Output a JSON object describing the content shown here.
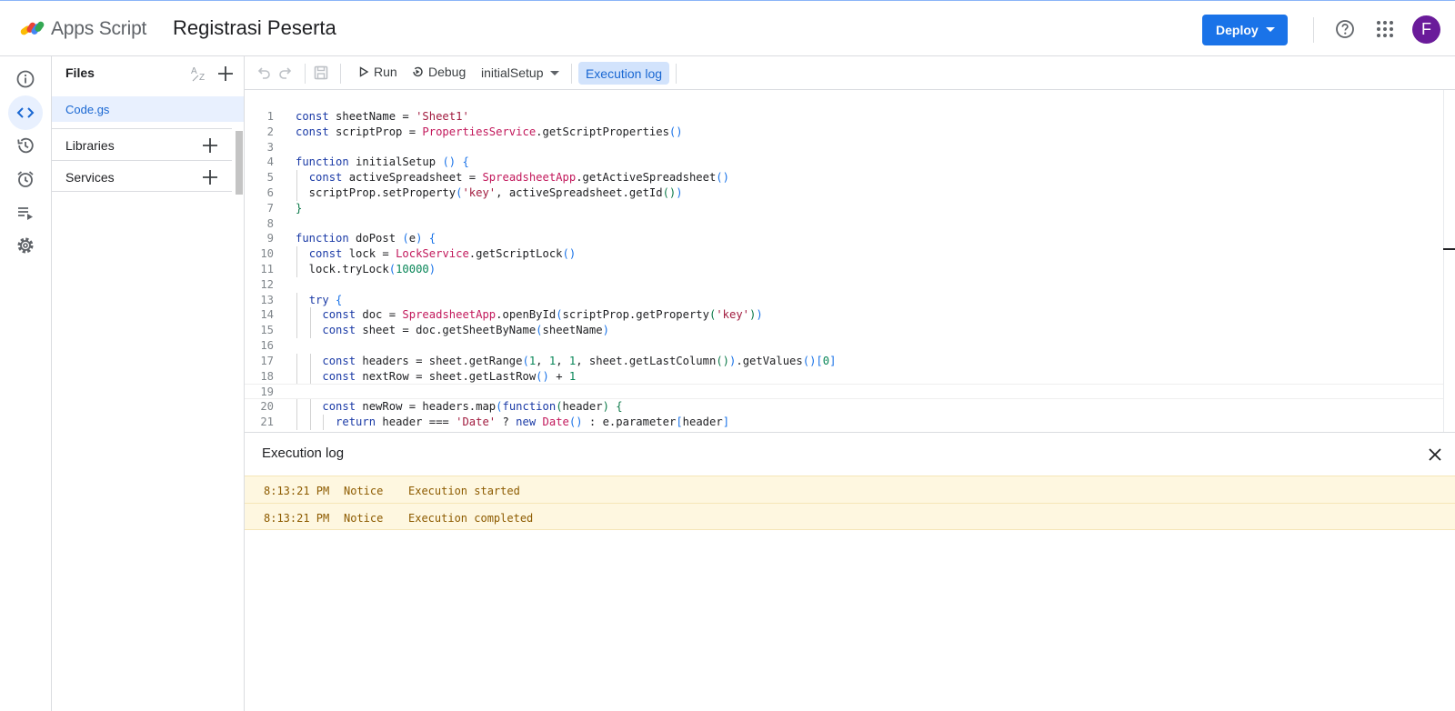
{
  "header": {
    "app_name": "Apps Script",
    "project_title": "Registrasi Peserta",
    "deploy_label": "Deploy",
    "avatar_initial": "F"
  },
  "rail": {
    "icons": [
      "info-icon",
      "code-icon",
      "history-icon",
      "alarm-icon",
      "executions-icon",
      "settings-icon"
    ],
    "active": "code-icon"
  },
  "files": {
    "title": "Files",
    "items": [
      {
        "name": "Code.gs",
        "selected": true
      }
    ],
    "sections": [
      {
        "label": "Libraries"
      },
      {
        "label": "Services"
      }
    ]
  },
  "toolbar": {
    "run_label": "Run",
    "debug_label": "Debug",
    "function_selected": "initialSetup",
    "exec_log_label": "Execution log"
  },
  "editor": {
    "current_line": 19,
    "lines": [
      "const sheetName = 'Sheet1'",
      "const scriptProp = PropertiesService.getScriptProperties()",
      "",
      "function initialSetup () {",
      "  const activeSpreadsheet = SpreadsheetApp.getActiveSpreadsheet()",
      "  scriptProp.setProperty('key', activeSpreadsheet.getId())",
      "}",
      "",
      "function doPost (e) {",
      "  const lock = LockService.getScriptLock()",
      "  lock.tryLock(10000)",
      "",
      "  try {",
      "    const doc = SpreadsheetApp.openById(scriptProp.getProperty('key'))",
      "    const sheet = doc.getSheetByName(sheetName)",
      "",
      "    const headers = sheet.getRange(1, 1, 1, sheet.getLastColumn()).getValues()[0]",
      "    const nextRow = sheet.getLastRow() + 1",
      "",
      "    const newRow = headers.map(function(header) {",
      "      return header === 'Date' ? new Date() : e.parameter[header]"
    ]
  },
  "execution_log": {
    "title": "Execution log",
    "entries": [
      {
        "time": "8:13:21 PM",
        "level": "Notice",
        "message": "Execution started"
      },
      {
        "time": "8:13:21 PM",
        "level": "Notice",
        "message": "Execution completed"
      }
    ]
  },
  "colors": {
    "accent": "#1a73e8",
    "selected_bg": "#e8f0fe",
    "log_row_bg": "#fef7e0",
    "log_text": "#8d5b00",
    "avatar_bg": "#6a1b9a"
  }
}
